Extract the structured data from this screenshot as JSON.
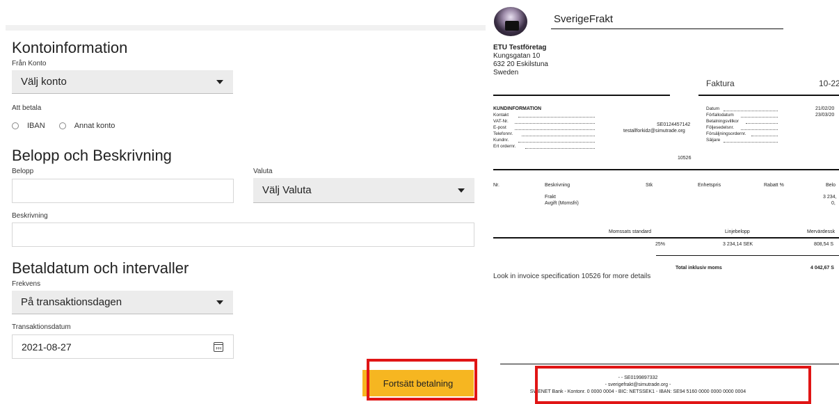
{
  "form": {
    "account_section": {
      "title": "Kontoinformation",
      "from_account_label": "Från Konto",
      "from_account_value": "Välj konto",
      "to_pay_label": "Att betala",
      "radio_options": [
        "IBAN",
        "Annat konto"
      ]
    },
    "amount_section": {
      "title": "Belopp och Beskrivning",
      "amount_label": "Belopp",
      "amount_value": "",
      "currency_label": "Valuta",
      "currency_value": "Välj Valuta",
      "description_label": "Beskrivning",
      "description_value": ""
    },
    "date_section": {
      "title": "Betaldatum och intervaller",
      "frequency_label": "Frekvens",
      "frequency_value": "På transaktionsdagen",
      "transaction_date_label": "Transaktionsdatum",
      "transaction_date_value": "2021-08-27"
    },
    "continue_button": "Fortsätt betalning",
    "highlight_color": "#e01515",
    "button_color": "#f6b621"
  },
  "invoice": {
    "company_name": "SverigeFrakt",
    "recipient": {
      "name": "ETU Testföretag",
      "street": "Kungsgatan 10",
      "city": "632 20 Eskilstuna",
      "country": "Sweden"
    },
    "doc_type": "Faktura",
    "doc_number": "10-22",
    "customer_info": {
      "heading": "KUNDINFORMATION",
      "labels": [
        "Kontakt",
        "VAT-Nr.",
        "E-post",
        "Telefonnr.",
        "Kundnr.",
        "Ert ordernr."
      ],
      "vat_value": "SE0124457142",
      "email_value": "testallforkidz@simutrade.org",
      "order_value": "10526"
    },
    "invoice_info": {
      "labels": [
        "Datum",
        "Förfallodatum",
        "Betalningsvillkor",
        "Följesedelsnr.",
        "Försäljningsordernr.",
        "Säljare"
      ],
      "date_value": "21/02/20",
      "due_value": "23/03/20"
    },
    "line_headers": [
      "Nr.",
      "Beskrivning",
      "Stk",
      "Enhetspris",
      "Rabatt %",
      "Belo"
    ],
    "lines": [
      {
        "description": "Frakt",
        "amount": "3 234,"
      },
      {
        "description": "Avgift (Momsfri)",
        "amount": "0,"
      }
    ],
    "vat_headers": [
      "Momssats standard",
      "Linjebelopp",
      "Mervärdessk"
    ],
    "vat_values": [
      "25%",
      "3 234,14 SEK",
      "808,54 S"
    ],
    "total_label": "Total inklusiv moms",
    "total_value": "4 042,67 S",
    "note": "Look in invoice specification 10526 for more details",
    "footer": {
      "line1": "- - SE0199897332",
      "line2": "- sverigefrakt@simutrade.org -",
      "line3": "SWENET Bank - Kontonr. 0 0000 0004 - BIC: NETSSEK1 - IBAN: SE94 5160 0000 0000 0000 0004"
    }
  }
}
